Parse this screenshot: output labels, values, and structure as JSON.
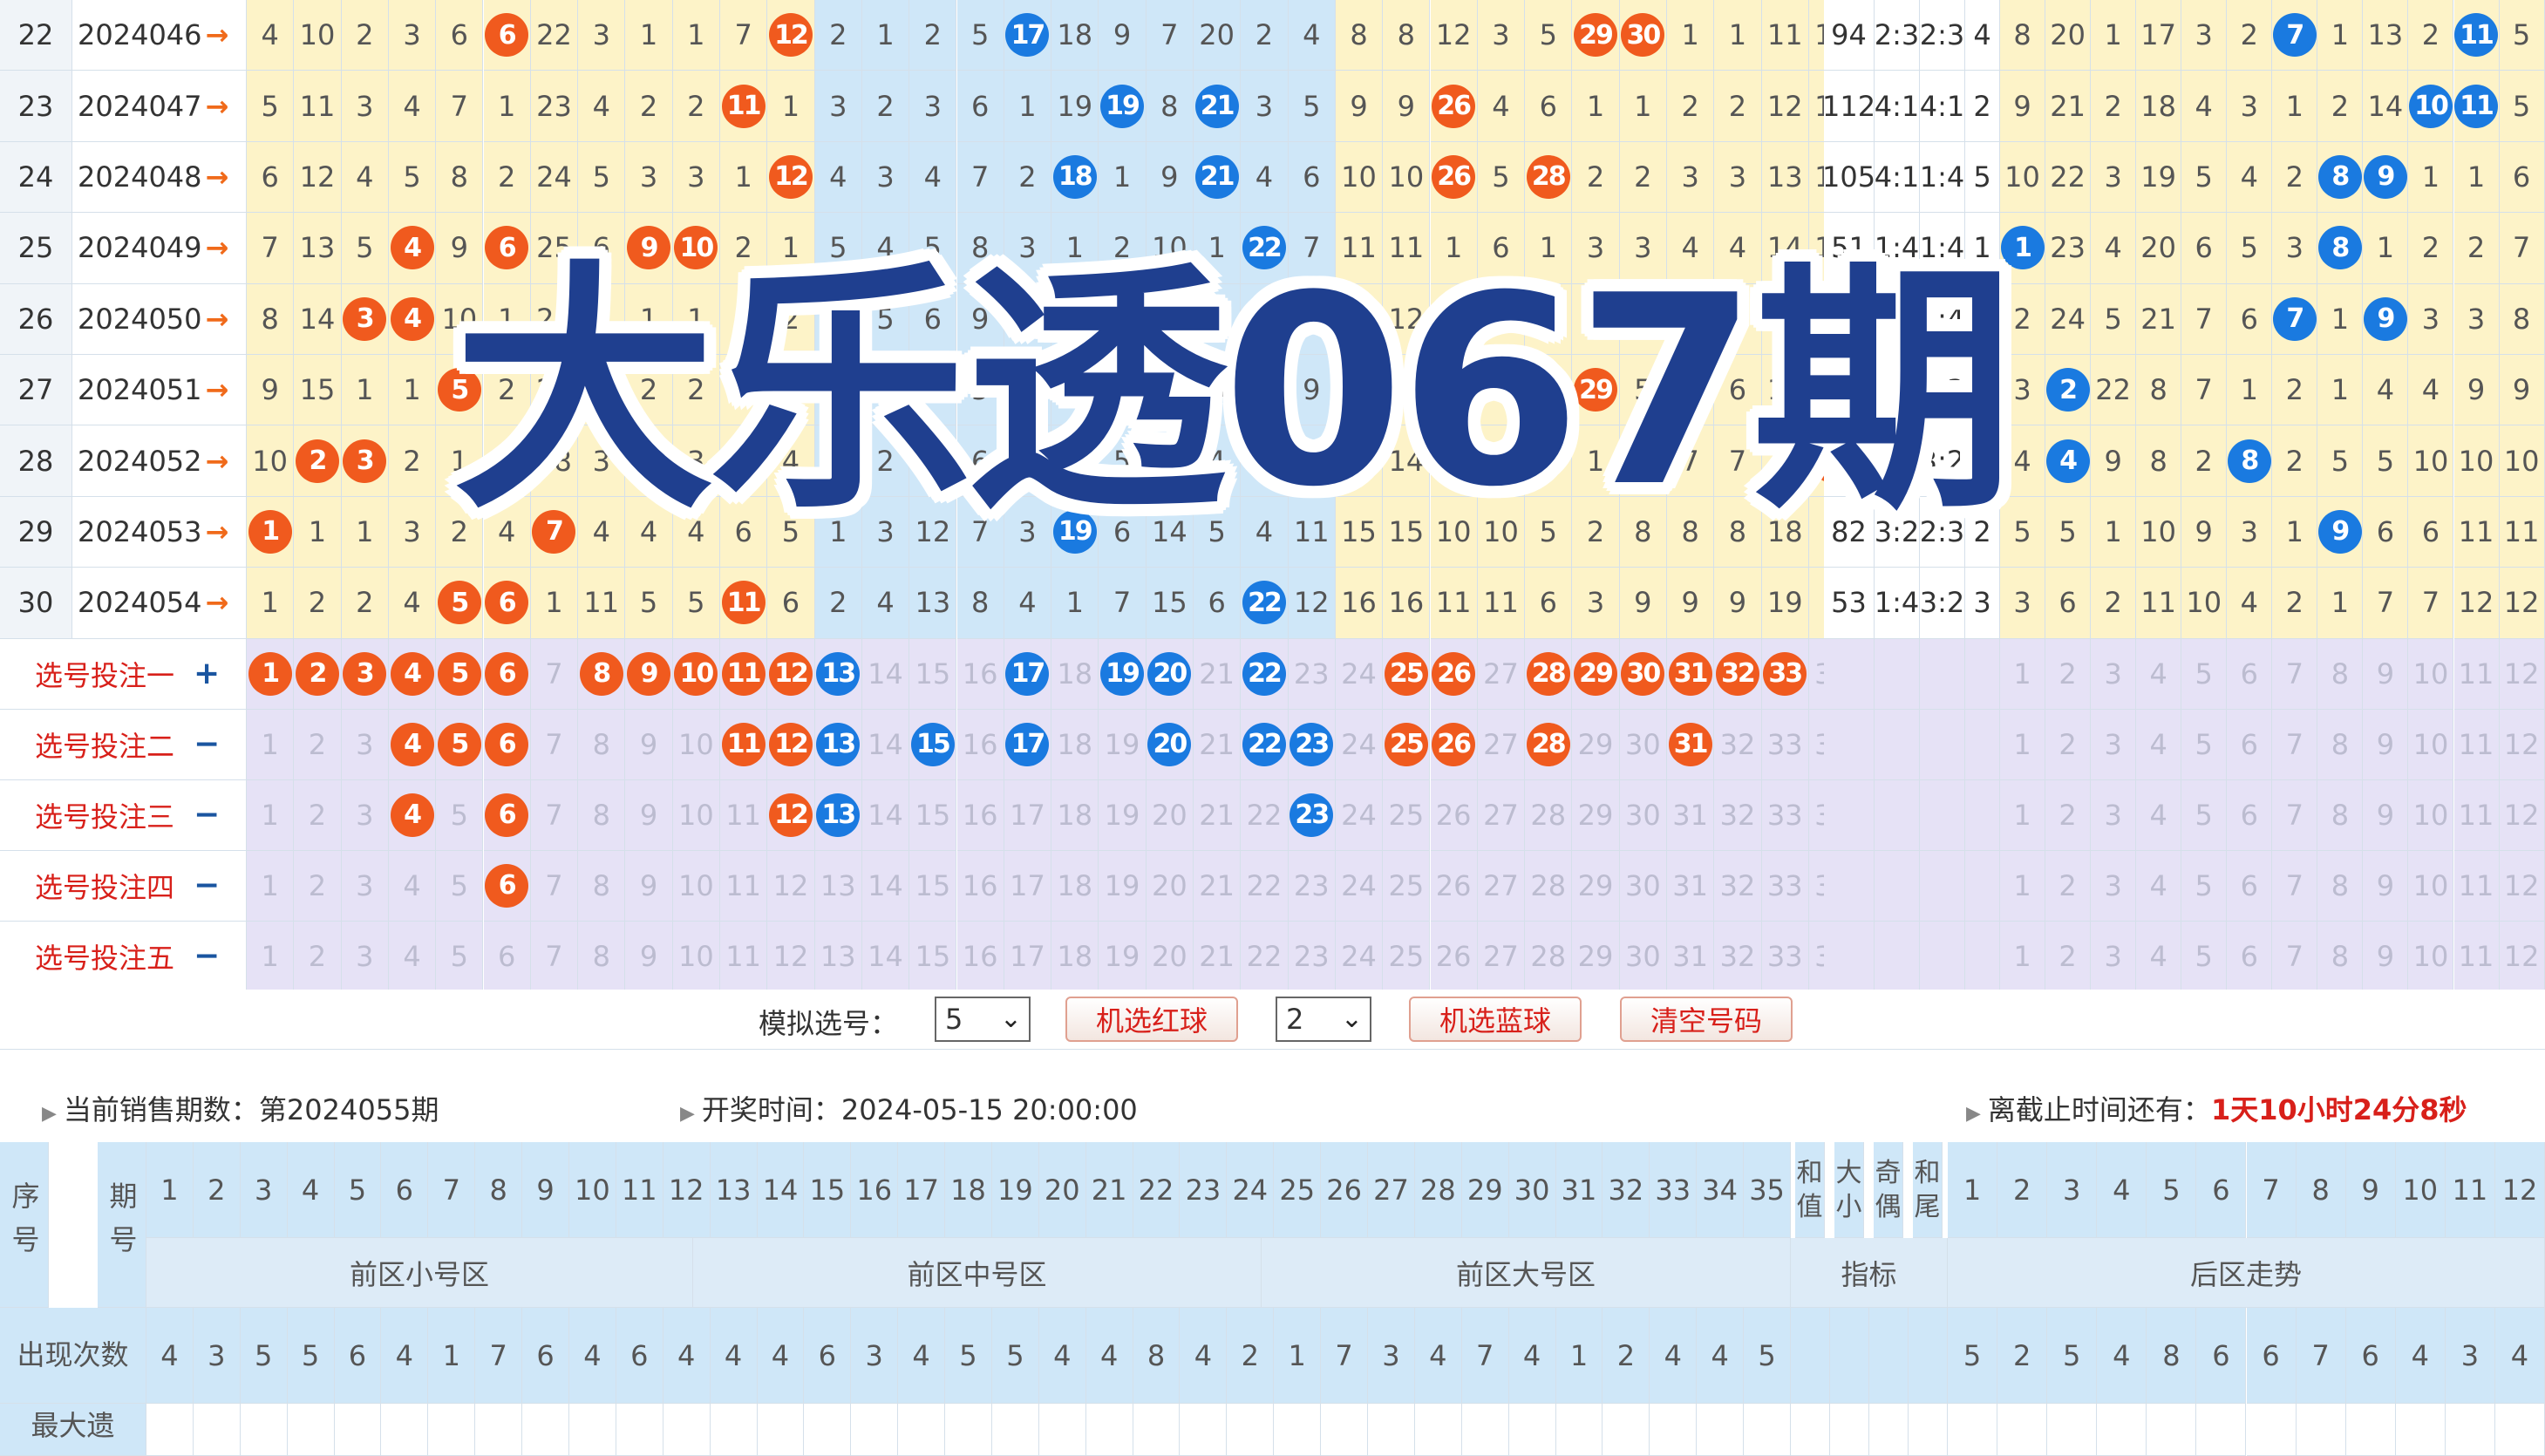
{
  "rows": [
    {
      "n": "22",
      "issue": "2024046",
      "front": [
        "4",
        "10",
        "2",
        "3",
        "6",
        "6",
        "22",
        "3",
        "1",
        "1",
        "7",
        "12",
        "2",
        "1",
        "2",
        "5",
        "17",
        "18",
        "9",
        "7",
        "20",
        "2",
        "4",
        "8",
        "8",
        "12",
        "3",
        "5",
        "29",
        "30",
        "1",
        "1",
        "11",
        "10",
        "4"
      ],
      "reds": [
        5,
        11,
        28,
        29
      ],
      "blues": [
        16
      ],
      "stats": [
        "94",
        "2:3",
        "2:3",
        "4"
      ],
      "back": [
        "8",
        "20",
        "1",
        "17",
        "3",
        "2",
        "7",
        "1",
        "13",
        "2",
        "11",
        "5"
      ],
      "bball": [
        6,
        10
      ]
    },
    {
      "n": "23",
      "issue": "2024047",
      "front": [
        "5",
        "11",
        "3",
        "4",
        "7",
        "1",
        "23",
        "4",
        "2",
        "2",
        "11",
        "1",
        "3",
        "2",
        "3",
        "6",
        "1",
        "19",
        "19",
        "8",
        "21",
        "3",
        "5",
        "9",
        "9",
        "26",
        "4",
        "6",
        "1",
        "1",
        "2",
        "2",
        "12",
        "11",
        "35"
      ],
      "reds": [
        10,
        25,
        34
      ],
      "blues": [
        18,
        20
      ],
      "stats": [
        "112",
        "4:1",
        "4:1",
        "2"
      ],
      "back": [
        "9",
        "21",
        "2",
        "18",
        "4",
        "3",
        "1",
        "2",
        "14",
        "10",
        "11",
        "5"
      ],
      "bball": [
        9,
        10
      ]
    },
    {
      "n": "24",
      "issue": "2024048",
      "front": [
        "6",
        "12",
        "4",
        "5",
        "8",
        "2",
        "24",
        "5",
        "3",
        "3",
        "1",
        "12",
        "4",
        "3",
        "4",
        "7",
        "2",
        "18",
        "1",
        "9",
        "21",
        "4",
        "6",
        "10",
        "10",
        "26",
        "5",
        "28",
        "2",
        "2",
        "3",
        "3",
        "13",
        "12",
        "1"
      ],
      "reds": [
        11,
        25,
        27
      ],
      "blues": [
        17,
        20
      ],
      "stats": [
        "105",
        "4:1",
        "1:4",
        "5"
      ],
      "back": [
        "10",
        "22",
        "3",
        "19",
        "5",
        "4",
        "2",
        "8",
        "9",
        "1",
        "1",
        "6"
      ],
      "bball": [
        7,
        8
      ]
    },
    {
      "n": "25",
      "issue": "2024049",
      "front": [
        "7",
        "13",
        "5",
        "4",
        "9",
        "6",
        "25",
        "6",
        "9",
        "10",
        "2",
        "1",
        "5",
        "4",
        "5",
        "8",
        "3",
        "1",
        "2",
        "10",
        "1",
        "22",
        "7",
        "11",
        "11",
        "1",
        "6",
        "1",
        "3",
        "3",
        "4",
        "4",
        "14",
        "13",
        "2"
      ],
      "reds": [
        3,
        5,
        8,
        9
      ],
      "blues": [
        21
      ],
      "stats": [
        "51",
        "1:4",
        "1:4",
        "1"
      ],
      "back": [
        "1",
        "23",
        "4",
        "20",
        "6",
        "5",
        "3",
        "8",
        "1",
        "2",
        "2",
        "7"
      ],
      "bball": [
        0,
        7
      ]
    },
    {
      "n": "26",
      "issue": "2024050",
      "front": [
        "8",
        "14",
        "3",
        "4",
        "10",
        "1",
        "26",
        "1",
        "1",
        "1",
        "3",
        "2",
        "6",
        "5",
        "6",
        "9",
        "4",
        "18",
        "3",
        "11",
        "2",
        "1",
        "8",
        "12",
        "12",
        "26",
        "7",
        "2",
        "4",
        "4",
        "5",
        "5",
        "15",
        "14",
        "3"
      ],
      "reds": [
        2,
        3,
        25
      ],
      "blues": [
        17
      ],
      "stats": [
        "65",
        "2:3",
        "1:4",
        "1"
      ],
      "back": [
        "2",
        "24",
        "5",
        "21",
        "7",
        "6",
        "7",
        "1",
        "9",
        "3",
        "3",
        "8"
      ],
      "bball": [
        6,
        8
      ]
    },
    {
      "n": "27",
      "issue": "2024051",
      "front": [
        "9",
        "15",
        "1",
        "1",
        "5",
        "2",
        "27",
        "2",
        "2",
        "2",
        "4",
        "3",
        "7",
        "1",
        "10",
        "5",
        "1",
        "4",
        "4",
        "12",
        "3",
        "2",
        "9",
        "13",
        "13",
        "2",
        "8",
        "3",
        "29",
        "5",
        "6",
        "6",
        "16",
        "15",
        "4"
      ],
      "reds": [
        4,
        28
      ],
      "blues": [],
      "stats": [
        "80",
        "2:3",
        "2:3",
        "0"
      ],
      "back": [
        "3",
        "2",
        "22",
        "8",
        "7",
        "1",
        "2",
        "1",
        "4",
        "4",
        "9",
        "9"
      ],
      "bball": [
        1
      ]
    },
    {
      "n": "28",
      "issue": "2024052",
      "front": [
        "10",
        "2",
        "3",
        "2",
        "1",
        "3",
        "28",
        "3",
        "3",
        "3",
        "5",
        "4",
        "8",
        "2",
        "11",
        "6",
        "2",
        "2",
        "5",
        "13",
        "4",
        "3",
        "10",
        "14",
        "14",
        "9",
        "9",
        "4",
        "1",
        "6",
        "7",
        "7",
        "17",
        "34",
        "5"
      ],
      "reds": [
        1,
        2,
        33
      ],
      "blues": [],
      "stats": [
        "74",
        "2:3",
        "3:2",
        "4"
      ],
      "back": [
        "4",
        "4",
        "9",
        "8",
        "2",
        "8",
        "2",
        "5",
        "5",
        "10",
        "10",
        "10"
      ],
      "bball": [
        1,
        5
      ]
    },
    {
      "n": "29",
      "issue": "2024053",
      "front": [
        "1",
        "1",
        "1",
        "3",
        "2",
        "4",
        "7",
        "4",
        "4",
        "4",
        "6",
        "5",
        "1",
        "3",
        "12",
        "7",
        "3",
        "19",
        "6",
        "14",
        "5",
        "4",
        "11",
        "15",
        "15",
        "10",
        "10",
        "5",
        "2",
        "8",
        "8",
        "8",
        "18",
        "1",
        "6"
      ],
      "reds": [
        0,
        6
      ],
      "blues": [
        17
      ],
      "stats": [
        "82",
        "3:2",
        "2:3",
        "2"
      ],
      "back": [
        "5",
        "5",
        "1",
        "10",
        "9",
        "3",
        "1",
        "9",
        "6",
        "6",
        "11",
        "11"
      ],
      "bball": [
        7
      ]
    },
    {
      "n": "30",
      "issue": "2024054",
      "front": [
        "1",
        "2",
        "2",
        "4",
        "5",
        "6",
        "1",
        "11",
        "5",
        "5",
        "11",
        "6",
        "2",
        "4",
        "13",
        "8",
        "4",
        "1",
        "7",
        "15",
        "6",
        "22",
        "12",
        "16",
        "16",
        "11",
        "11",
        "6",
        "3",
        "9",
        "9",
        "9",
        "19",
        "2",
        "7"
      ],
      "reds": [
        4,
        5,
        10
      ],
      "blues": [
        21
      ],
      "stats": [
        "53",
        "1:4",
        "3:2",
        "3"
      ],
      "back": [
        "3",
        "6",
        "2",
        "11",
        "10",
        "4",
        "2",
        "1",
        "7",
        "7",
        "12",
        "12"
      ],
      "bball": []
    }
  ],
  "selections": [
    {
      "label": "选号投注一",
      "sign": "+",
      "reds": [
        1,
        2,
        3,
        4,
        5,
        6,
        8,
        9,
        10,
        11,
        12,
        25,
        26,
        28,
        29,
        30,
        31,
        32,
        33,
        35
      ],
      "blues": [
        13,
        17,
        19,
        20,
        22
      ],
      "bluesBack": []
    },
    {
      "label": "选号投注二",
      "sign": "−",
      "reds": [
        4,
        5,
        6,
        11,
        12,
        25,
        26,
        28,
        31,
        35
      ],
      "blues": [
        13,
        15,
        17,
        20,
        22,
        23
      ],
      "bluesBack": []
    },
    {
      "label": "选号投注三",
      "sign": "−",
      "reds": [
        4,
        6,
        12
      ],
      "blues": [
        13,
        23
      ],
      "bluesBack": []
    },
    {
      "label": "选号投注四",
      "sign": "−",
      "reds": [
        6
      ],
      "blues": [],
      "bluesBack": []
    },
    {
      "label": "选号投注五",
      "sign": "−",
      "reds": [],
      "blues": [],
      "bluesBack": []
    }
  ],
  "overlay_title": "大乐透067期",
  "controls": {
    "sim_label": "模拟选号：",
    "red_count": "5",
    "red_button": "机选红球",
    "blue_count": "2",
    "blue_button": "机选蓝球",
    "clear_button": "清空号码"
  },
  "info": {
    "current": "当前销售期数：第2024055期",
    "draw_time": "开奖时间：2024-05-15 20:00:00",
    "deadline_label": "离截止时间还有：",
    "deadline_value": "1天10小时24分8秒"
  },
  "header": {
    "seq": "序号",
    "issue": "期号",
    "front_small": "前区小号区",
    "front_mid": "前区中号区",
    "front_big": "前区大号区",
    "indicators": "指标",
    "back_trend": "后区走势",
    "sum": "和值",
    "size": "大小",
    "odd": "奇偶",
    "tail": "和尾",
    "appear_label": "出现次数",
    "maxmiss_label": "最大遗",
    "appear_front": [
      "4",
      "3",
      "5",
      "5",
      "6",
      "4",
      "1",
      "7",
      "6",
      "4",
      "6",
      "4",
      "4",
      "4",
      "6",
      "3",
      "4",
      "5",
      "5",
      "4",
      "4",
      "8",
      "4",
      "2",
      "1",
      "7",
      "3",
      "4",
      "7",
      "4",
      "1",
      "2",
      "4",
      "4",
      "5"
    ],
    "appear_back": [
      "5",
      "2",
      "5",
      "4",
      "8",
      "6",
      "6",
      "7",
      "6",
      "4",
      "3",
      "4"
    ]
  },
  "colors": {
    "red_ball": "#f05a1e",
    "blue_ball": "#1a7ae0",
    "title": "#1f3f8f",
    "yellow": "#fdf3c8",
    "blue_bg": "#cfe7f8",
    "purple": "#e6e2f6"
  }
}
